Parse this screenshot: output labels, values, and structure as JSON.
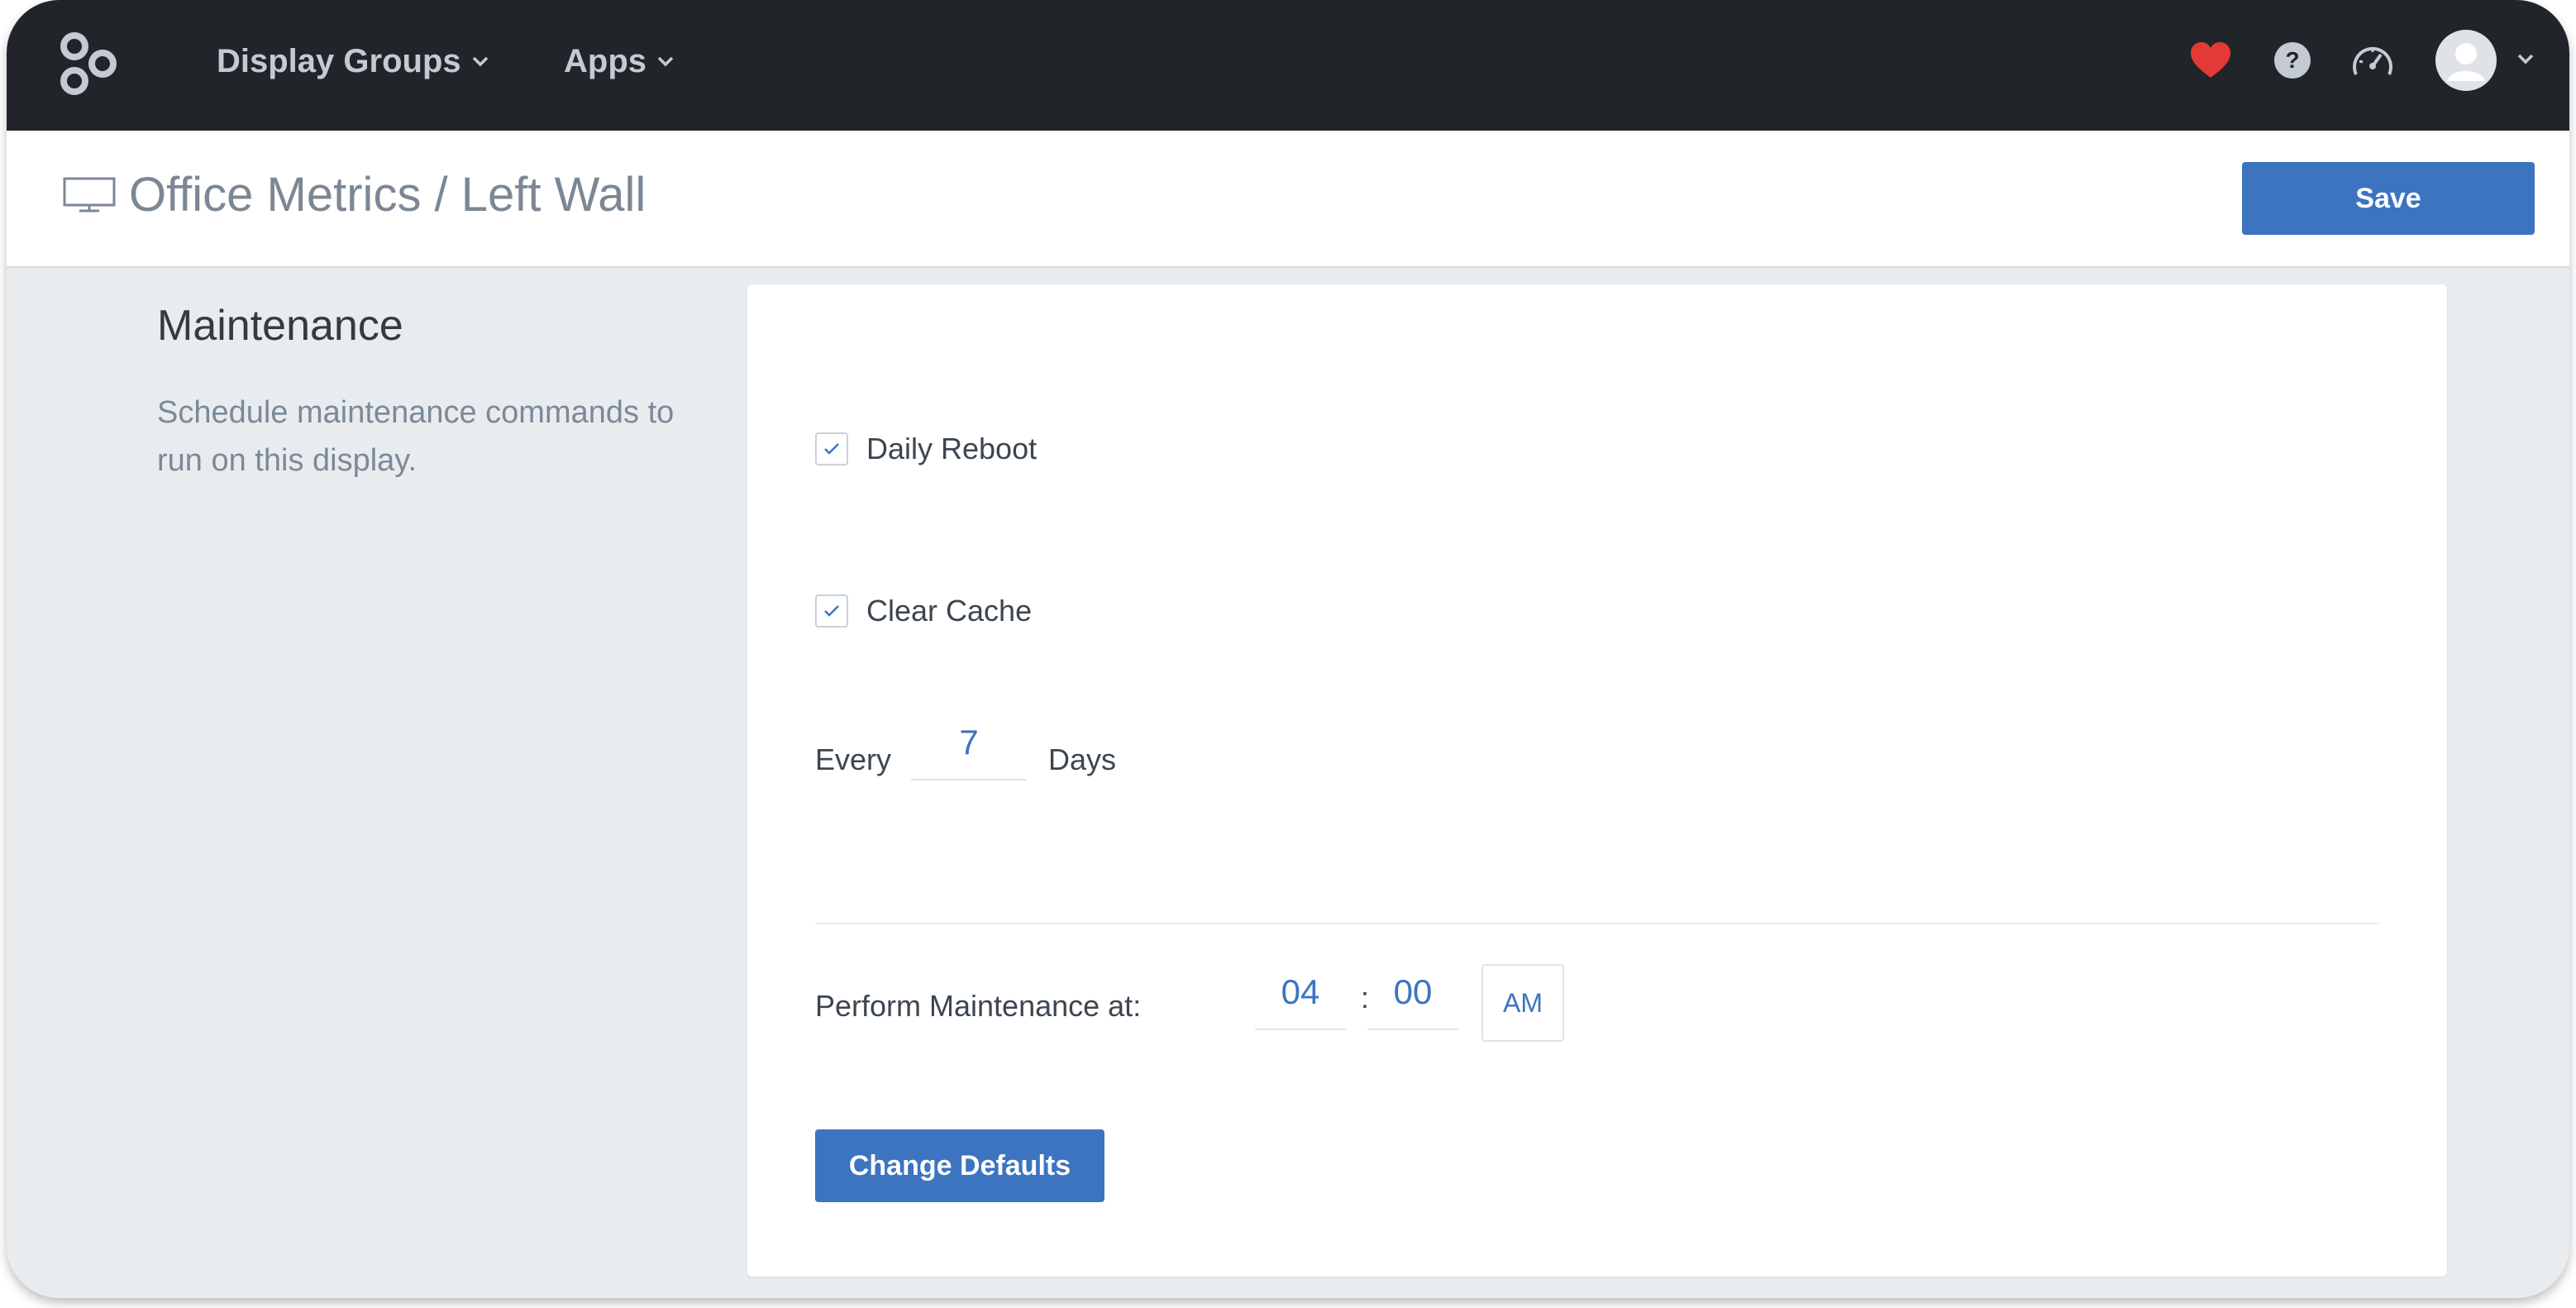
{
  "nav": {
    "logo_icon": "logo-icon",
    "items": [
      {
        "label": "Display Groups",
        "icon": "chevron-down-icon"
      },
      {
        "label": "Apps",
        "icon": "chevron-down-icon"
      }
    ],
    "right_icons": [
      "heart-icon",
      "help-icon",
      "gauge-icon",
      "avatar",
      "chevron-down-icon"
    ]
  },
  "header": {
    "icon": "monitor-icon",
    "title": "Office Metrics / Left Wall",
    "save_label": "Save"
  },
  "section": {
    "title": "Maintenance",
    "description": "Schedule maintenance commands to run on this display."
  },
  "maintenance": {
    "daily_reboot": {
      "label": "Daily Reboot",
      "checked": true
    },
    "clear_cache": {
      "label": "Clear Cache",
      "checked": true
    },
    "every_label": "Every",
    "days_value": "7",
    "days_label": "Days",
    "perform_label": "Perform Maintenance at:",
    "hour": "04",
    "separator": ":",
    "minute": "00",
    "ampm": "AM",
    "change_defaults_label": "Change Defaults"
  },
  "colors": {
    "nav_bg": "#212529",
    "accent": "#3d74c0",
    "heart": "#e53935",
    "page_bg": "#e9ecef"
  }
}
